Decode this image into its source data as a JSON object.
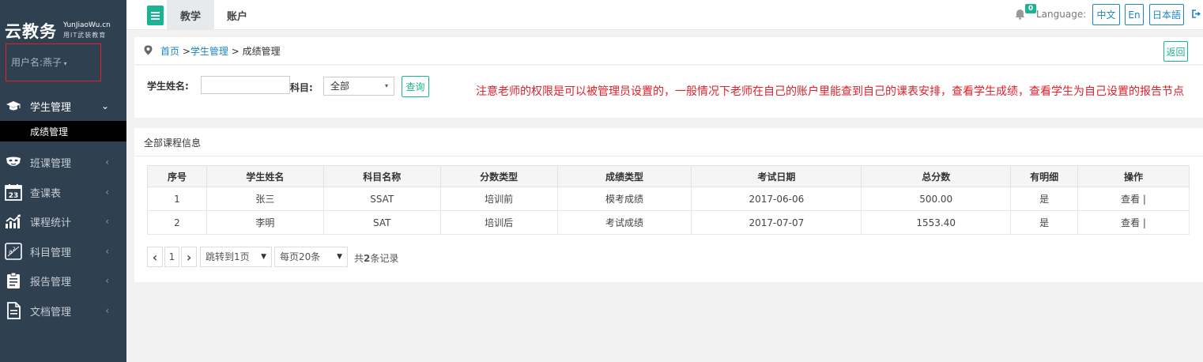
{
  "sidebar": {
    "logo_main": "云教务",
    "logo_sub1": "YunJiaoWu.cn",
    "logo_sub2": "用IT武装教育",
    "user_label": "用户名:燕子",
    "items": [
      {
        "label": "学生管理",
        "icon": "graduation-cap-icon",
        "arrow": "⌄"
      },
      {
        "label": "班课管理",
        "icon": "mask-icon",
        "arrow": "‹"
      },
      {
        "label": "查课表",
        "icon": "calendar-icon",
        "arrow": "‹"
      },
      {
        "label": "课程统计",
        "icon": "chart-icon",
        "arrow": "‹"
      },
      {
        "label": "科目管理",
        "icon": "formula-icon",
        "arrow": "‹"
      },
      {
        "label": "报告管理",
        "icon": "clipboard-icon",
        "arrow": "‹"
      },
      {
        "label": "文档管理",
        "icon": "document-icon",
        "arrow": "‹"
      }
    ],
    "sub_item": "成绩管理"
  },
  "topbar": {
    "tabs": [
      "教学",
      "账户"
    ],
    "notification_count": "0",
    "language_label": "Language:",
    "languages": [
      "中文",
      "En",
      "日本語"
    ]
  },
  "breadcrumb": {
    "home": "首页",
    "sep1": " >",
    "section": "学生管理",
    "sep2": " > ",
    "current": "成绩管理",
    "back_label": "返回"
  },
  "search": {
    "name_label": "学生姓名:",
    "name_value": "",
    "subject_label": "科目:",
    "subject_value": "全部",
    "query_label": "查询"
  },
  "notice": "注意老师的权限是可以被管理员设置的，一般情况下老师在自己的账户里能查到自己的课表安排，查看学生成绩，查看学生为自己设置的报告节点",
  "panel": {
    "title": "全部课程信息",
    "columns": [
      "序号",
      "学生姓名",
      "科目名称",
      "分数类型",
      "成绩类型",
      "考试日期",
      "总分数",
      "有明细",
      "操作"
    ],
    "rows": [
      [
        "1",
        "张三",
        "SSAT",
        "培训前",
        "模考成绩",
        "2017-06-06",
        "500.00",
        "是",
        "查看 |"
      ],
      [
        "2",
        "李明",
        "SAT",
        "培训后",
        "考试成绩",
        "2017-07-07",
        "1553.40",
        "是",
        "查看 |"
      ]
    ]
  },
  "pager": {
    "prev": "‹",
    "page": "1",
    "next": "›",
    "jump_label": "跳转到1页",
    "per_page_label": "每页20条",
    "total_prefix": "共",
    "total_count": "2",
    "total_suffix": "条记录"
  },
  "colors": {
    "sidebar_bg": "#2f4050",
    "accent_green": "#1ab394",
    "link_blue": "#1c84c6",
    "notice_red": "#e0202a"
  }
}
